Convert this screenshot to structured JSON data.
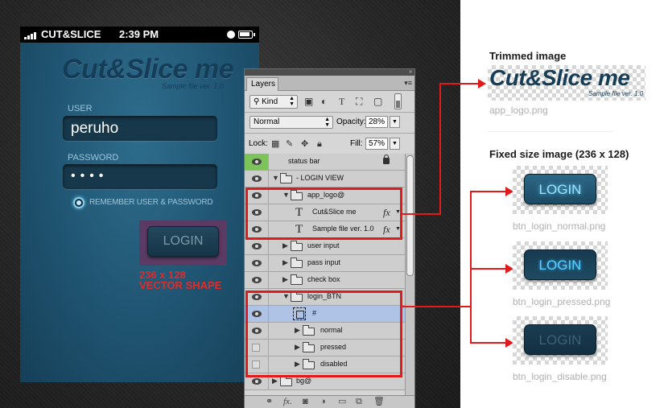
{
  "phone": {
    "carrier": "CUT&SLICE",
    "time": "2:39 PM",
    "logo": "Cut&Slice me",
    "logo_sub": "Sample file ver. 1.0",
    "user_label": "USER",
    "user_value": "peruho",
    "password_label": "PASSWORD",
    "password_value": "••••",
    "remember_label": "REMEMBER USER & PASSWORD",
    "login_button": "LOGIN",
    "shape_note_line1": "236 x 128",
    "shape_note_line2": "VECTOR SHAPE"
  },
  "layers_panel": {
    "tab": "Layers",
    "kind": "Kind",
    "blend_mode": "Normal",
    "opacity_label": "Opacity:",
    "opacity_value": "28%",
    "lock_label": "Lock:",
    "fill_label": "Fill:",
    "fill_value": "57%",
    "layers": [
      {
        "name": "status bar",
        "visible": true
      },
      {
        "name": "- LOGIN VIEW",
        "visible": true
      },
      {
        "name": "app_logo@",
        "visible": true
      },
      {
        "name": "Cut&Slice me",
        "visible": true
      },
      {
        "name": "Sample file ver. 1.0",
        "visible": true
      },
      {
        "name": "user input",
        "visible": true
      },
      {
        "name": "pass input",
        "visible": true
      },
      {
        "name": "check box",
        "visible": true
      },
      {
        "name": "login_BTN",
        "visible": true
      },
      {
        "name": "#",
        "visible": true
      },
      {
        "name": "normal",
        "visible": true
      },
      {
        "name": "pressed",
        "visible": false
      },
      {
        "name": "disabled",
        "visible": false
      },
      {
        "name": "bg@",
        "visible": true
      }
    ],
    "fx_label": "fx"
  },
  "right": {
    "trimmed_title": "Trimmed image",
    "trimmed_logo": "Cut&Slice me",
    "trimmed_sub": "Sample file ver. 1.0",
    "trimmed_file": "app_logo.png",
    "fixed_title": "Fixed size image (236 x 128)",
    "buttons": [
      {
        "label": "LOGIN",
        "file": "btn_login_normal.png"
      },
      {
        "label": "LOGIN",
        "file": "btn_login_pressed.png"
      },
      {
        "label": "LOGIN",
        "file": "btn_login_disable.png"
      }
    ]
  },
  "colors": {
    "highlight": "#e01b1b",
    "phone_bg": "#1f5471",
    "selected_layer": "#aec3e6",
    "visible_eye_active": "#7cc45a"
  }
}
